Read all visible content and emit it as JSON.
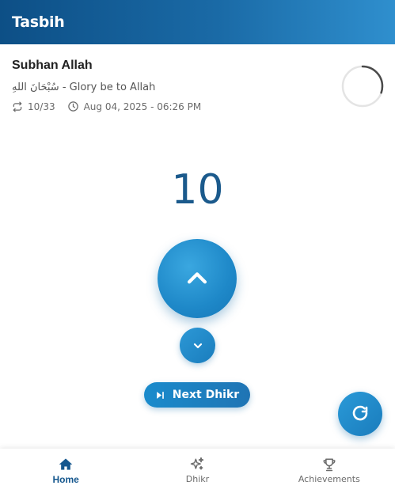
{
  "app_bar": {
    "title": "Tasbih"
  },
  "dhikr": {
    "title": "Subhan Allah",
    "arabic": "سُبْحَانَ اللهِ",
    "separator": " - ",
    "translation": "Glory be to Allah",
    "progress_text": "10/33",
    "timestamp": "Aug 04, 2025 - 06:26 PM",
    "progress_fraction": 0.303
  },
  "counter": {
    "value": "10"
  },
  "buttons": {
    "next_label": "Next Dhikr"
  },
  "bottom_nav": {
    "items": [
      {
        "label": "Home",
        "icon": "home-icon",
        "active": true
      },
      {
        "label": "Dhikr",
        "icon": "sparkles-icon",
        "active": false
      },
      {
        "label": "Achievements",
        "icon": "trophy-icon",
        "active": false
      }
    ]
  },
  "colors": {
    "primary": "#1a6aa6",
    "accent": "#1e88c8",
    "count_text": "#1b5a8c",
    "nav_active": "#15578e"
  }
}
